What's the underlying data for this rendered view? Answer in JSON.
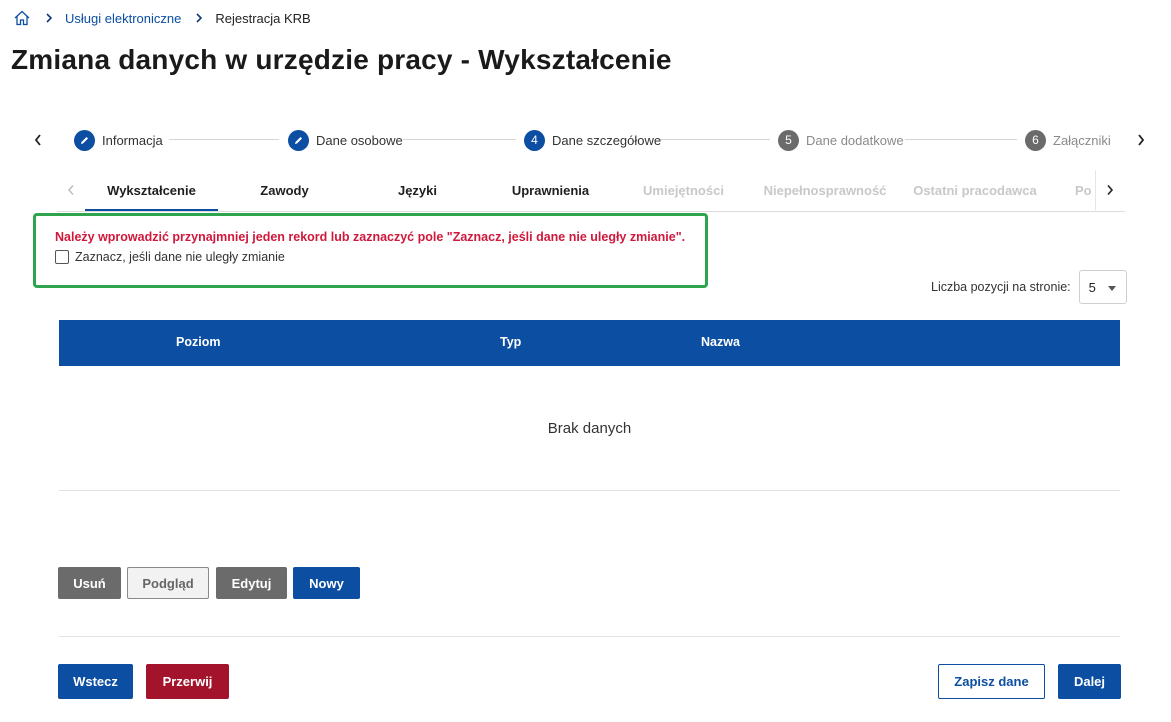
{
  "breadcrumb": {
    "home_icon": "home-icon",
    "items": [
      {
        "label": "Usługi elektroniczne"
      },
      {
        "label": "Rejestracja KRB"
      }
    ]
  },
  "page_title": "Zmiana danych w urzędzie pracy - Wykształcenie",
  "stepper": {
    "steps": [
      {
        "number": "",
        "label": "Informacja",
        "state": "done",
        "icon": "pencil-icon"
      },
      {
        "number": "",
        "label": "Dane osobowe",
        "state": "done",
        "icon": "pencil-icon"
      },
      {
        "number": "4",
        "label": "Dane szczegółowe",
        "state": "active"
      },
      {
        "number": "5",
        "label": "Dane dodatkowe",
        "state": "todo"
      },
      {
        "number": "6",
        "label": "Załączniki",
        "state": "todo"
      }
    ]
  },
  "tabs": {
    "items": [
      {
        "label": "Wykształcenie",
        "state": "active"
      },
      {
        "label": "Zawody",
        "state": "enabled"
      },
      {
        "label": "Języki",
        "state": "enabled"
      },
      {
        "label": "Uprawnienia",
        "state": "enabled"
      },
      {
        "label": "Umiejętności",
        "state": "disabled"
      },
      {
        "label": "Niepełnosprawność",
        "state": "disabled"
      },
      {
        "label": "Ostatni pracodawca",
        "state": "disabled"
      },
      {
        "label": "Po",
        "state": "disabled"
      }
    ]
  },
  "alert": {
    "message": "Należy wprowadzić przynajmniej jeden rekord lub zaznaczyć pole \"Zaznacz, jeśli dane nie uległy zmianie\".",
    "checkbox_label": "Zaznacz, jeśli dane nie uległy zmianie",
    "checked": false,
    "border_color": "#2ea44f",
    "text_color": "#d0183c"
  },
  "pagination": {
    "per_page_label": "Liczba pozycji na stronie:",
    "per_page_value": "5"
  },
  "table": {
    "columns": [
      "Poziom",
      "Typ",
      "Nazwa"
    ],
    "empty_text": "Brak danych",
    "header_color": "#0b4ea2"
  },
  "actions": {
    "delete": "Usuń",
    "preview": "Podgląd",
    "edit": "Edytuj",
    "new": "Nowy"
  },
  "footer": {
    "back": "Wstecz",
    "abort": "Przerwij",
    "save": "Zapisz dane",
    "next": "Dalej"
  }
}
